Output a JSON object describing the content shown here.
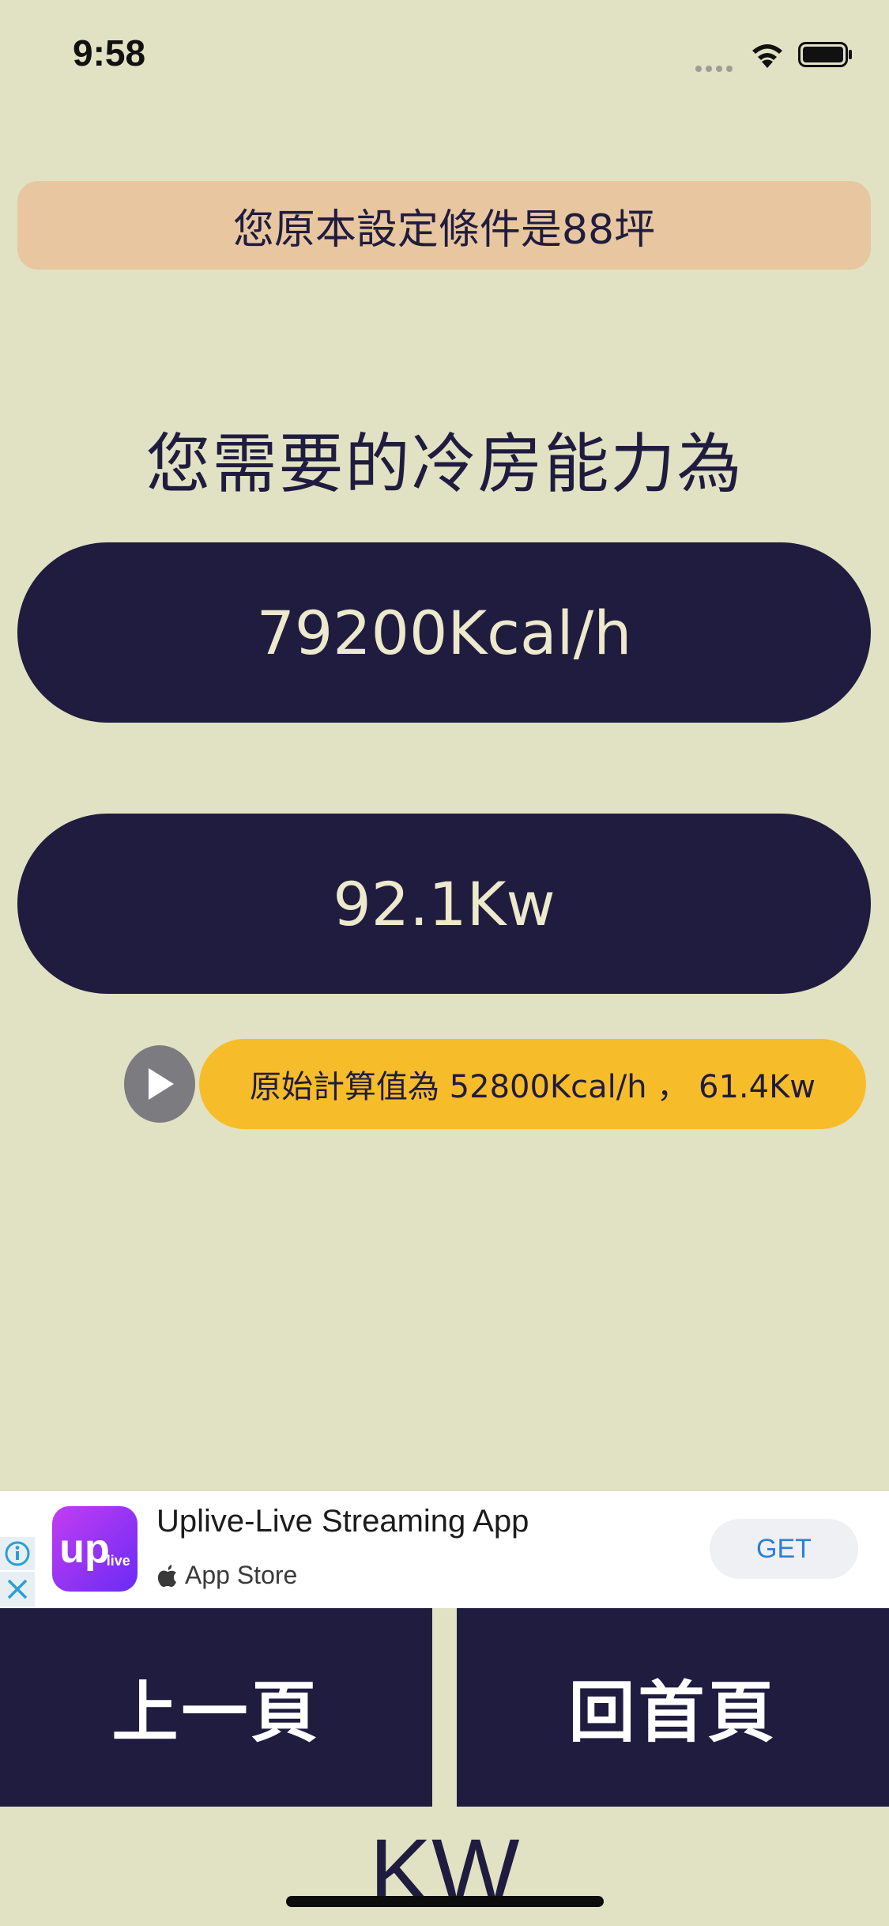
{
  "status_bar": {
    "time": "9:58"
  },
  "condition_banner": {
    "text": "您原本設定條件是88坪"
  },
  "heading": {
    "text": "您需要的冷房能力為"
  },
  "results": {
    "kcal": "79200Kcal/h",
    "kw": "92.1Kw"
  },
  "raw_calc": {
    "text": "原始計算值為 52800Kcal/h ， 61.4Kw"
  },
  "ad": {
    "app_name": "Uplive-Live Streaming App",
    "store": "App Store",
    "get_label": "GET",
    "icon_text": "up",
    "icon_subtext": "live"
  },
  "nav": {
    "prev_label": "上一頁",
    "home_label": "回首頁"
  },
  "unit_label": "KW",
  "colors": {
    "background": "#e1e2c3",
    "navy": "#201c3f",
    "banner": "#e8c7a0",
    "accent_yellow": "#f7bc2a"
  }
}
